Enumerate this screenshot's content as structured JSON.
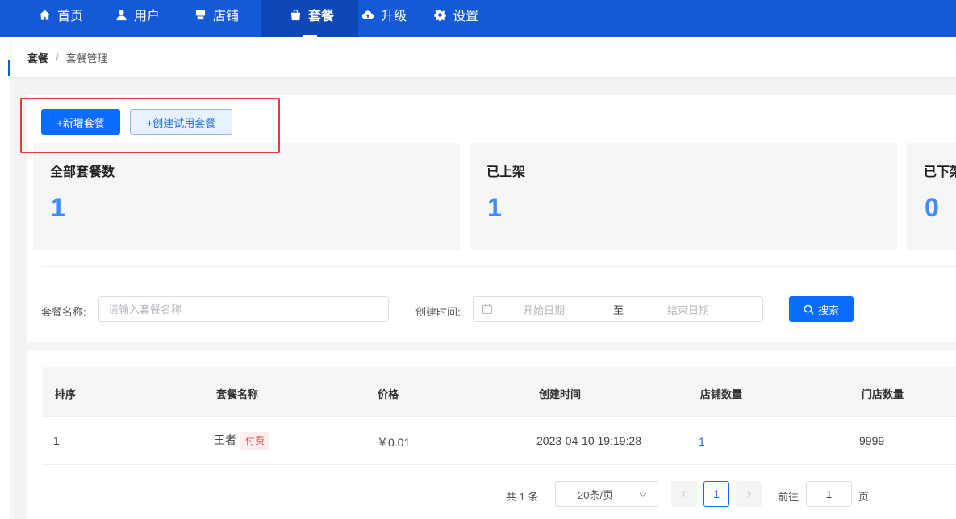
{
  "nav": {
    "items": [
      {
        "label": "首页",
        "icon": "home-icon"
      },
      {
        "label": "用户",
        "icon": "user-icon"
      },
      {
        "label": "店铺",
        "icon": "store-icon"
      },
      {
        "label": "套餐",
        "icon": "bag-icon",
        "active": true
      },
      {
        "label": "升级",
        "icon": "cloud-upload-icon"
      },
      {
        "label": "设置",
        "icon": "gear-icon"
      }
    ]
  },
  "breadcrumb": {
    "root": "套餐",
    "separator": "/",
    "current": "套餐管理"
  },
  "actions": {
    "add_label": "+新增套餐",
    "trial_label": "+创建试用套餐"
  },
  "stats": [
    {
      "title": "全部套餐数",
      "value": "1"
    },
    {
      "title": "已上架",
      "value": "1"
    },
    {
      "title": "已下架",
      "value": "0"
    }
  ],
  "filter": {
    "name_label": "套餐名称:",
    "name_placeholder": "请输入套餐名称",
    "time_label": "创建时间:",
    "start_placeholder": "开始日期",
    "range_separator": "至",
    "end_placeholder": "结束日期",
    "search_label": "搜索"
  },
  "table": {
    "columns": [
      "排序",
      "套餐名称",
      "价格",
      "创建时间",
      "店铺数量",
      "门店数量"
    ],
    "rows": [
      {
        "order": "1",
        "name": "王者",
        "tag": "付费",
        "price": "￥0.01",
        "created": "2023-04-10 19:19:28",
        "stores": "1",
        "shops": "9999"
      }
    ]
  },
  "pagination": {
    "total": "共 1 条",
    "page_size": "20条/页",
    "current": "1",
    "goto_label": "前往",
    "goto_value": "1",
    "page_suffix": "页"
  },
  "colors": {
    "primary": "#0b6dff",
    "nav_bg": "#1559d6",
    "stat_value": "#3f8cff",
    "highlight_border": "#e53a36"
  }
}
